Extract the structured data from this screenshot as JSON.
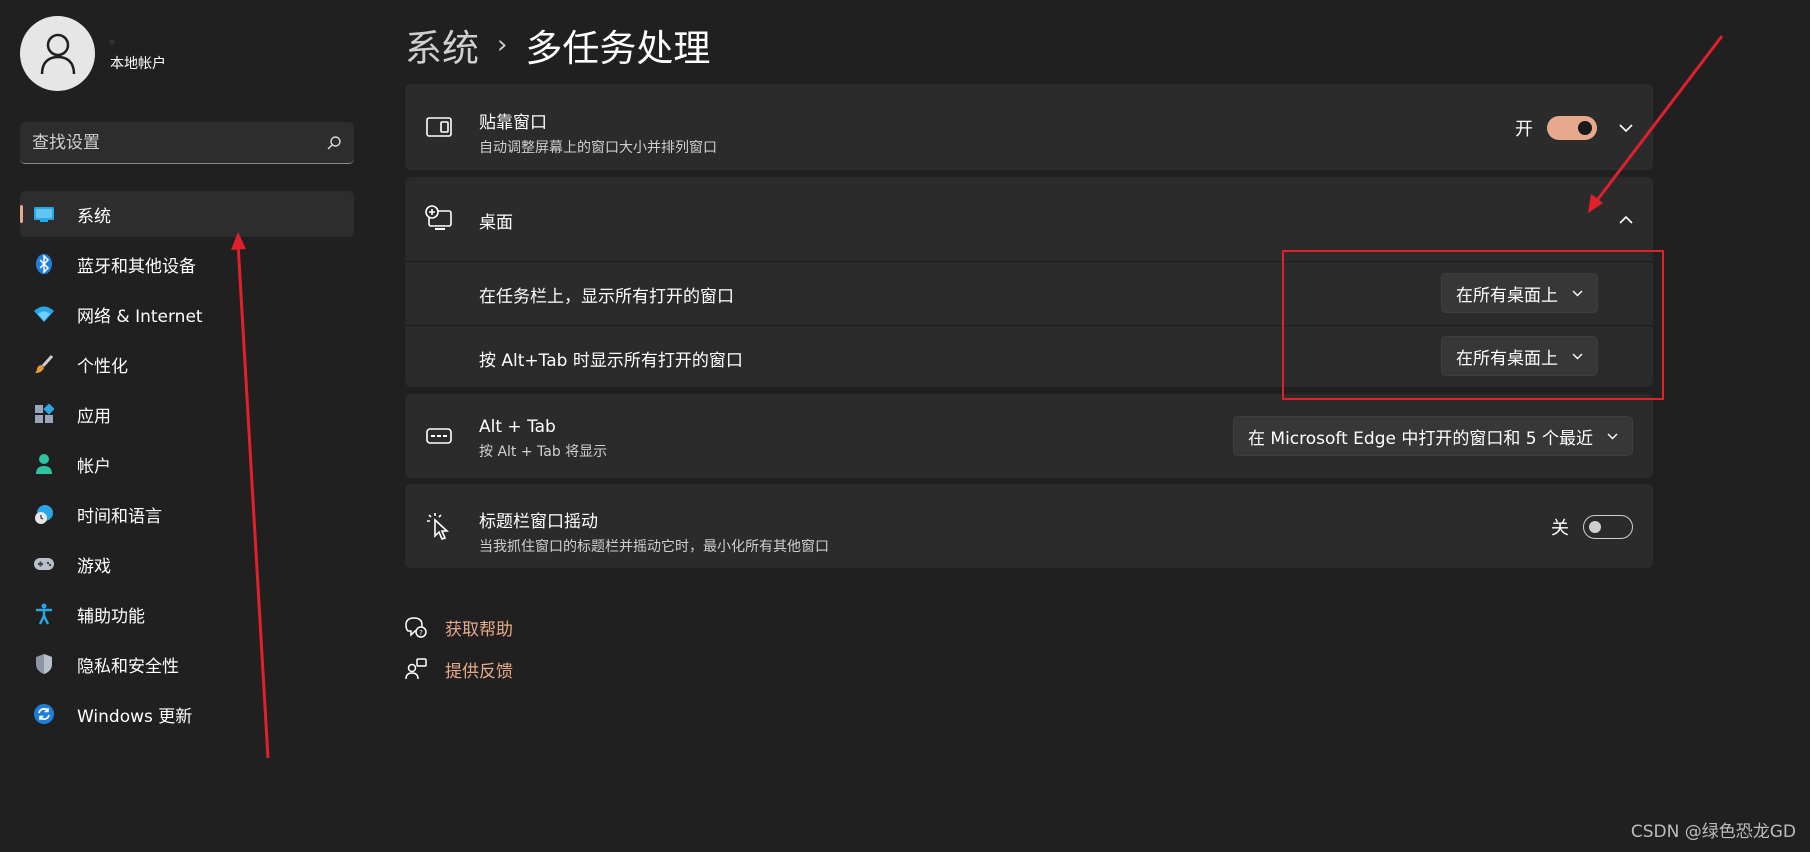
{
  "profile": {
    "name": "·",
    "account_type": "本地帐户"
  },
  "search": {
    "placeholder": "查找设置"
  },
  "sidebar": {
    "items": [
      {
        "label": "系统",
        "icon": "monitor-icon",
        "active": true
      },
      {
        "label": "蓝牙和其他设备",
        "icon": "bluetooth-icon"
      },
      {
        "label": "网络 & Internet",
        "icon": "wifi-icon"
      },
      {
        "label": "个性化",
        "icon": "brush-icon"
      },
      {
        "label": "应用",
        "icon": "apps-icon"
      },
      {
        "label": "帐户",
        "icon": "person-icon"
      },
      {
        "label": "时间和语言",
        "icon": "globe-clock-icon"
      },
      {
        "label": "游戏",
        "icon": "gamepad-icon"
      },
      {
        "label": "辅助功能",
        "icon": "accessibility-icon"
      },
      {
        "label": "隐私和安全性",
        "icon": "shield-icon"
      },
      {
        "label": "Windows 更新",
        "icon": "sync-icon"
      }
    ]
  },
  "breadcrumb": {
    "parent": "系统",
    "separator": "›",
    "current": "多任务处理"
  },
  "snap": {
    "title": "贴靠窗口",
    "desc": "自动调整屏幕上的窗口大小并排列窗口",
    "state_label": "开",
    "enabled": true
  },
  "desktops": {
    "title": "桌面",
    "taskbar_label": "在任务栏上，显示所有打开的窗口",
    "taskbar_value": "在所有桌面上",
    "alttab_label": "按 Alt+Tab 时显示所有打开的窗口",
    "alttab_value": "在所有桌面上"
  },
  "alttab": {
    "title": "Alt + Tab",
    "desc": "按 Alt + Tab 将显示",
    "value": "在 Microsoft Edge 中打开的窗口和 5 个最近"
  },
  "shake": {
    "title": "标题栏窗口摇动",
    "desc": "当我抓住窗口的标题栏并摇动它时，最小化所有其他窗口",
    "state_label": "关",
    "enabled": false
  },
  "links": {
    "help": "获取帮助",
    "feedback": "提供反馈"
  },
  "watermark": "CSDN @绿色恐龙GD",
  "colors": {
    "accent": "#e7a98b",
    "background": "#202020",
    "card": "#2b2b2b",
    "annotation": "#e0202a"
  }
}
